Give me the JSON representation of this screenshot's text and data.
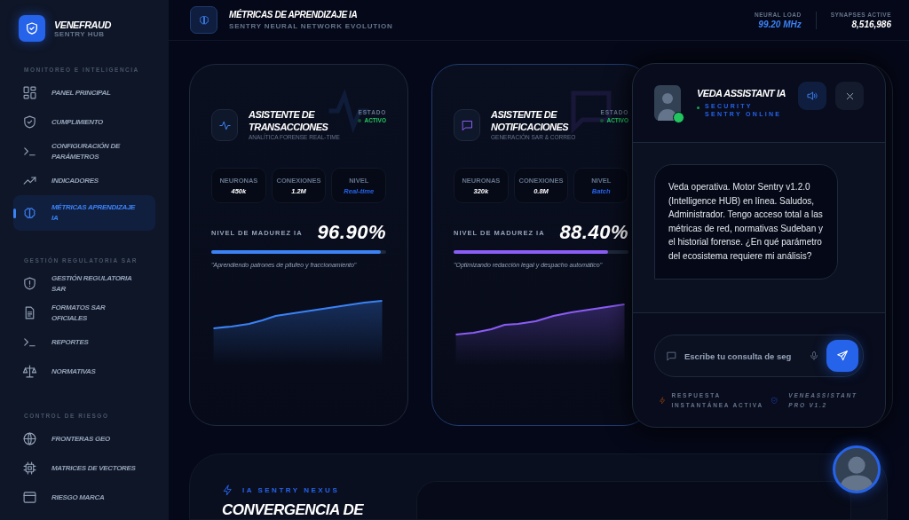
{
  "sidebar": {
    "brand": {
      "name": "VENEFRAUD",
      "subtitle": "SENTRY HUB"
    },
    "sections": [
      {
        "title": "MONITOREO E INTELIGENCIA",
        "items": [
          {
            "label": "PANEL PRINCIPAL",
            "selected": false
          },
          {
            "label": "CUMPLIMIENTO",
            "selected": false
          },
          {
            "label": "CONFIGURACIÓN DE PARÁMETROS",
            "selected": false
          },
          {
            "label": "INDICADORES",
            "selected": false
          },
          {
            "label": "MÉTRICAS APRENDIZAJE IA",
            "selected": true
          }
        ]
      },
      {
        "title": "GESTIÓN REGULATORIA SAR",
        "items": [
          {
            "label": "GESTIÓN REGULATORIA SAR",
            "selected": false
          },
          {
            "label": "FORMATOS SAR OFICIALES",
            "selected": false
          },
          {
            "label": "REPORTES",
            "selected": false
          },
          {
            "label": "NORMATIVAS",
            "selected": false
          }
        ]
      },
      {
        "title": "CONTROL DE RIESGO",
        "items": [
          {
            "label": "FRONTERAS GEO",
            "selected": false
          },
          {
            "label": "MATRICES DE VECTORES",
            "selected": false
          },
          {
            "label": "RIESGO MARCA",
            "selected": false
          }
        ]
      }
    ]
  },
  "header": {
    "title": "MÉTRICAS DE APRENDIZAJE IA",
    "subtitle": "SENTRY NEURAL NETWORK EVOLUTION",
    "stats": [
      {
        "label": "NEURAL LOAD",
        "value": "99.20 MHz",
        "highlighted": true
      },
      {
        "label": "SYNAPSES ACTIVE",
        "value": "8,516,986",
        "highlighted": false
      }
    ]
  },
  "cards": [
    {
      "title": "ASISTENTE DE TRANSACCIONES",
      "subtitle": "ANALÍTICA FORENSE REAL-TIME",
      "status_label": "ESTADO",
      "status": "ACTIVO",
      "active": true,
      "color": "#3b82f6",
      "metrics": [
        {
          "label": "NEURONAS",
          "value": "450k",
          "highlighted": false
        },
        {
          "label": "CONEXIONES",
          "value": "1.2M",
          "highlighted": false
        },
        {
          "label": "NIVEL",
          "value": "Real-time",
          "highlighted": true
        }
      ],
      "maturity_label": "NIVEL DE MADUREZ IA",
      "maturity_value": "96.90%",
      "level": 0.969,
      "quote": "\"Aprendiendo patrones de pitufeo y fraccionamiento\""
    },
    {
      "title": "ASISTENTE DE NOTIFICACIONES",
      "subtitle": "GENERACIÓN SAR & CORREO",
      "status_label": "ESTADO",
      "status": "ACTIVO",
      "active": true,
      "color": "#8b5cf6",
      "metrics": [
        {
          "label": "NEURONAS",
          "value": "320k",
          "highlighted": false
        },
        {
          "label": "CONEXIONES",
          "value": "0.8M",
          "highlighted": false
        },
        {
          "label": "NIVEL",
          "value": "Batch",
          "highlighted": true
        }
      ],
      "maturity_label": "NIVEL DE MADUREZ IA",
      "maturity_value": "88.40%",
      "level": 0.884,
      "quote": "\"Optimizando redacción legal y despacho automático\""
    }
  ],
  "chat": {
    "name": "VEDA ASSISTANT IA",
    "status": "SECURITY SENTRY ONLINE",
    "online": true,
    "message": "Veda operativa. Motor Sentry v1.2.0 (Intelligence HUB) en línea. Saludos, Administrador. Tengo acceso total a las métricas de red, normativas Sudeban y el historial forense. ¿En qué parámetro del ecosistema requiere mi análisis?",
    "placeholder": "Escribe tu consulta de seg",
    "notes": [
      "RESPUESTA INSTANTÁNEA ACTIVA",
      "VENEASSISTANT PRO V1.2"
    ]
  },
  "nexus": {
    "label": "IA SENTRY NEXUS",
    "heading": "CONVERGENCIA DE"
  }
}
